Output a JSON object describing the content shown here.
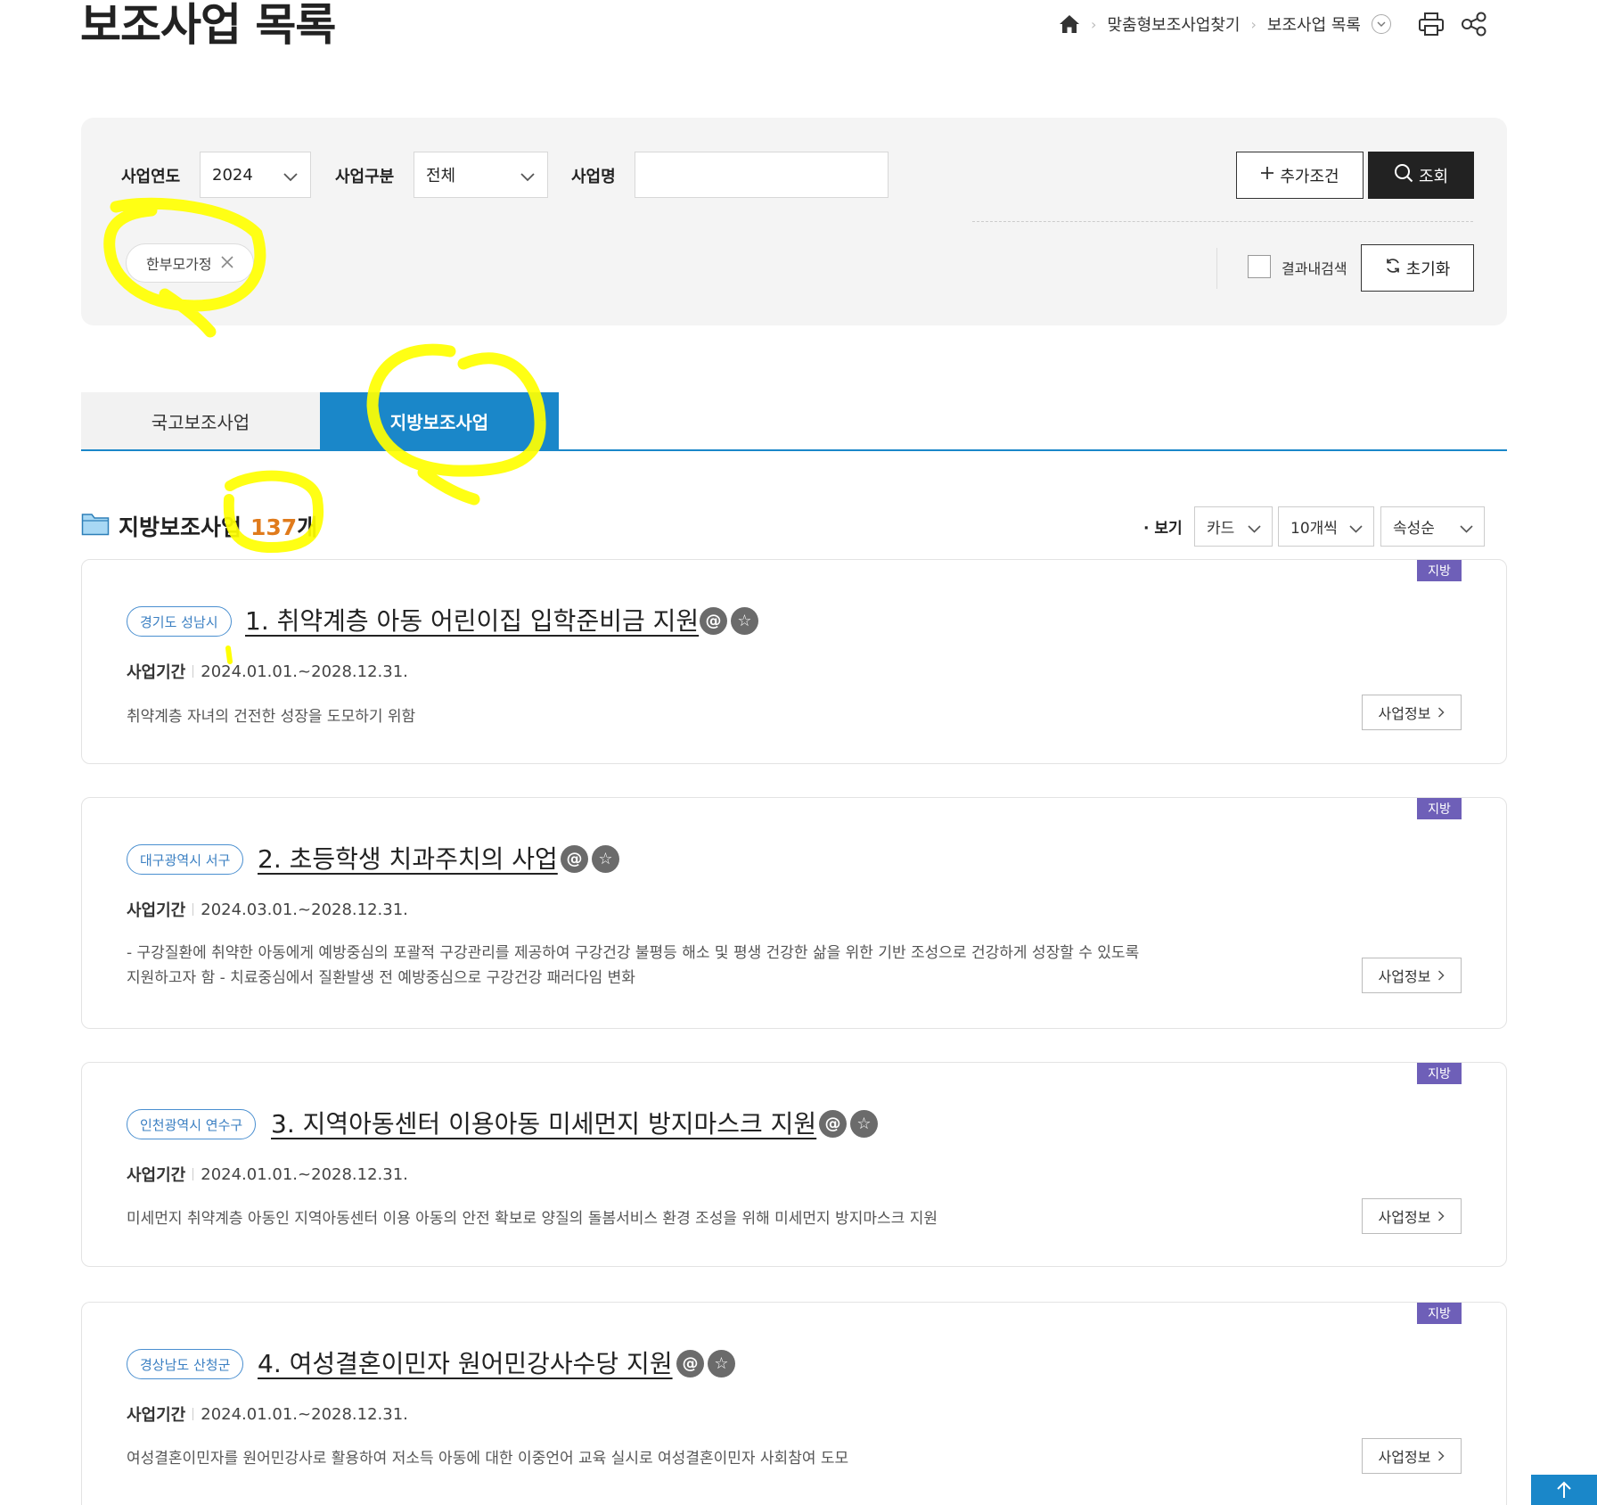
{
  "page": {
    "title": "보조사업 목록"
  },
  "breadcrumb": {
    "items": [
      "맞춤형보조사업찾기",
      "보조사업 목록"
    ],
    "icons": {
      "home": "home-icon",
      "print": "print-icon",
      "share": "share-icon",
      "dropdown": "chevron-down-icon"
    }
  },
  "search": {
    "year_label": "사업연도",
    "year_value": "2024",
    "type_label": "사업구분",
    "type_value": "전체",
    "name_label": "사업명",
    "name_value": "",
    "add_condition": "추가조건",
    "search_button": "조회",
    "chip": "한부모가정",
    "within_results": "결과내검색",
    "reset": "초기화"
  },
  "tabs": [
    {
      "label": "국고보조사업",
      "active": false
    },
    {
      "label": "지방보조사업",
      "active": true
    }
  ],
  "results": {
    "title": "지방보조사업",
    "count": "137",
    "unit": "개",
    "view_label": "· 보기",
    "view_mode": "카드",
    "page_size": "10개씩",
    "sort": "속성순"
  },
  "cards": [
    {
      "badge": "지방",
      "region": "경기도 성남시",
      "title": "1. 취약계층 아동 어린이집 입학준비금 지원",
      "period_label": "사업기간",
      "period": "2024.01.01.~2028.12.31.",
      "description": "취약계층 자녀의 건전한 성장을 도모하기 위함",
      "info_button": "사업정보"
    },
    {
      "badge": "지방",
      "region": "대구광역시 서구",
      "title": "2. 초등학생 치과주치의 사업",
      "period_label": "사업기간",
      "period": "2024.03.01.~2028.12.31.",
      "description": "- 구강질환에 취약한 아동에게 예방중심의 포괄적 구강관리를 제공하여 구강건강 불평등 해소 및 평생 건강한 삶을 위한 기반 조성으로 건강하게 성장할 수 있도록 지원하고자 함 - 치료중심에서 질환발생 전 예방중심으로 구강건강 패러다임 변화",
      "info_button": "사업정보"
    },
    {
      "badge": "지방",
      "region": "인천광역시 연수구",
      "title": "3. 지역아동센터 이용아동 미세먼지 방지마스크 지원",
      "period_label": "사업기간",
      "period": "2024.01.01.~2028.12.31.",
      "description": "미세먼지 취약계층 아동인 지역아동센터 이용 아동의 안전 확보로 양질의 돌봄서비스 환경 조성을 위해 미세먼지 방지마스크 지원",
      "info_button": "사업정보"
    },
    {
      "badge": "지방",
      "region": "경상남도 산청군",
      "title": "4. 여성결혼이민자 원어민강사수당 지원",
      "period_label": "사업기간",
      "period": "2024.01.01.~2028.12.31.",
      "description": "여성결혼이민자를 원어민강사로 활용하여 저소득 아동에 대한 이중언어 교육 실시로 여성결혼이민자 사회참여 도모",
      "info_button": "사업정보"
    }
  ],
  "colors": {
    "accent": "#1a87c9",
    "count": "#e07b1c",
    "badge": "#6e5fb8",
    "highlight": "#ffff00"
  }
}
